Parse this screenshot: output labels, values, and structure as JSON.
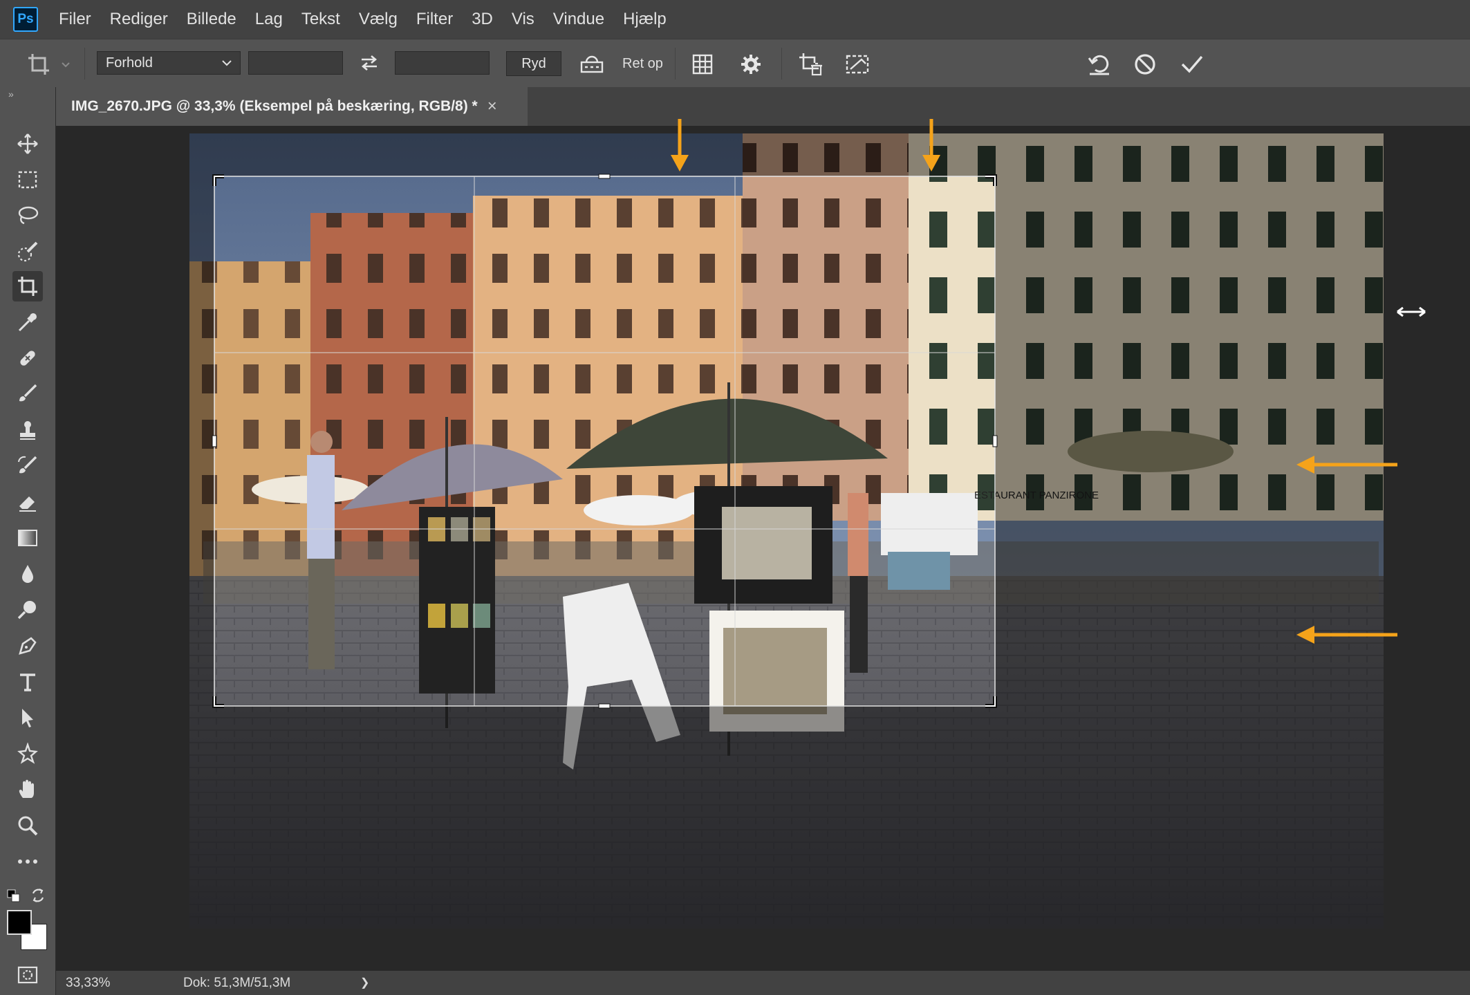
{
  "app": {
    "logo_text": "Ps"
  },
  "menu": [
    "Filer",
    "Rediger",
    "Billede",
    "Lag",
    "Tekst",
    "Vælg",
    "Filter",
    "3D",
    "Vis",
    "Vindue",
    "Hjælp"
  ],
  "options_bar": {
    "tool_icon": "crop-icon",
    "aspect_select": "Forhold",
    "width_value": "",
    "height_value": "",
    "clear_label": "Ryd",
    "straighten_label": "Ret op"
  },
  "document": {
    "tab_title": "IMG_2670.JPG @ 33,3% (Eksempel på beskæring, RGB/8) *",
    "close_symbol": "×",
    "photo_sign_text": "ESTAURANT PANZIRONE"
  },
  "status": {
    "zoom": "33,33%",
    "doc_info": "Dok: 51,3M/51,3M",
    "arrow": "❯"
  },
  "colors": {
    "annotation_arrow": "#f5a31a",
    "menubar": "#424242",
    "optionsbar": "#535353"
  }
}
